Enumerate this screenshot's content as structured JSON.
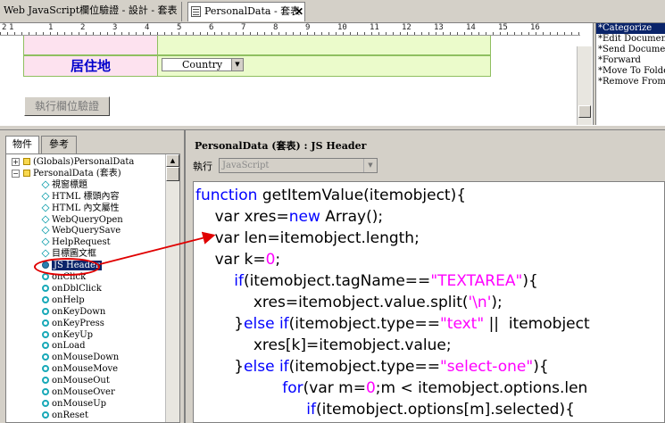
{
  "tabs": [
    {
      "label": "Web JavaScript欄位驗證 - 設計 - 套表"
    },
    {
      "label": "PersonalData - 套表",
      "close": "✕"
    }
  ],
  "ruler": {
    "marks": [
      "2",
      "1",
      "1",
      "2",
      "3",
      "4",
      "5",
      "6",
      "7",
      "8",
      "9",
      "10",
      "11",
      "12",
      "13",
      "14",
      "15",
      "16"
    ]
  },
  "form": {
    "residence_label": "居住地",
    "country_value": "Country",
    "validate_button": "執行欄位驗證"
  },
  "actions": [
    "*Categorize",
    "*Edit Document",
    "*Send Document",
    "*Forward",
    "*Move To Folder",
    "*Remove From Folder"
  ],
  "left_panel": {
    "tab_objects": "物件",
    "tab_reference": "參考"
  },
  "tree": {
    "items": [
      {
        "label": "(Globals)PersonalData",
        "expander": "+"
      },
      {
        "label": "PersonalData (套表)",
        "expander": "−"
      },
      {
        "label": "視窗標題"
      },
      {
        "label": "HTML 標頭內容"
      },
      {
        "label": "HTML 內文屬性"
      },
      {
        "label": "WebQueryOpen"
      },
      {
        "label": "WebQuerySave"
      },
      {
        "label": "HelpRequest"
      },
      {
        "label": "目標圖文框"
      },
      {
        "label": "JS Header"
      },
      {
        "label": "onClick"
      },
      {
        "label": "onDblClick"
      },
      {
        "label": "onHelp"
      },
      {
        "label": "onKeyDown"
      },
      {
        "label": "onKeyPress"
      },
      {
        "label": "onKeyUp"
      },
      {
        "label": "onLoad"
      },
      {
        "label": "onMouseDown"
      },
      {
        "label": "onMouseMove"
      },
      {
        "label": "onMouseOut"
      },
      {
        "label": "onMouseOver"
      },
      {
        "label": "onMouseUp"
      },
      {
        "label": "onReset"
      }
    ]
  },
  "code_panel": {
    "title": "PersonalData (套表) : JS Header",
    "run_label": "執行",
    "language": "JavaScript"
  },
  "code_lines": [
    [
      [
        "kw",
        "function"
      ],
      [
        "t",
        " getItemValue(itemobject){"
      ]
    ],
    [
      [
        "t",
        "    var xres="
      ],
      [
        "kw",
        "new"
      ],
      [
        "t",
        " Array();"
      ]
    ],
    [
      [
        "t",
        "    var len=itemobject.length;"
      ]
    ],
    [
      [
        "t",
        "    var k="
      ],
      [
        "num",
        "0"
      ],
      [
        "t",
        ";"
      ]
    ],
    [
      [
        "t",
        "        "
      ],
      [
        "kw",
        "if"
      ],
      [
        "t",
        "(itemobject.tagName=="
      ],
      [
        "str",
        "\"TEXTAREA\""
      ],
      [
        "t",
        "){"
      ]
    ],
    [
      [
        "t",
        "            xres=itemobject.value.split("
      ],
      [
        "str",
        "'\\n'"
      ],
      [
        "t",
        ");"
      ]
    ],
    [
      [
        "t",
        "        }"
      ],
      [
        "kw",
        "else if"
      ],
      [
        "t",
        "(itemobject.type=="
      ],
      [
        "str",
        "\"text\""
      ],
      [
        "t",
        " ||  itemobject"
      ]
    ],
    [
      [
        "t",
        "            xres[k]=itemobject.value;"
      ]
    ],
    [
      [
        "t",
        "        }"
      ],
      [
        "kw",
        "else if"
      ],
      [
        "t",
        "(itemobject.type=="
      ],
      [
        "str",
        "\"select-one\""
      ],
      [
        "t",
        "){"
      ]
    ],
    [
      [
        "t",
        "                  "
      ],
      [
        "kw",
        "for"
      ],
      [
        "t",
        "(var m="
      ],
      [
        "num",
        "0"
      ],
      [
        "t",
        ";m < itemobject.options.len"
      ]
    ],
    [
      [
        "t",
        "                       "
      ],
      [
        "kw",
        "if"
      ],
      [
        "t",
        "(itemobject.options[m].selected){"
      ]
    ]
  ],
  "colors": {
    "keyword": "#0000ff",
    "string": "#ff00ff",
    "selection": "#0a246a",
    "annotation": "#e00000"
  }
}
